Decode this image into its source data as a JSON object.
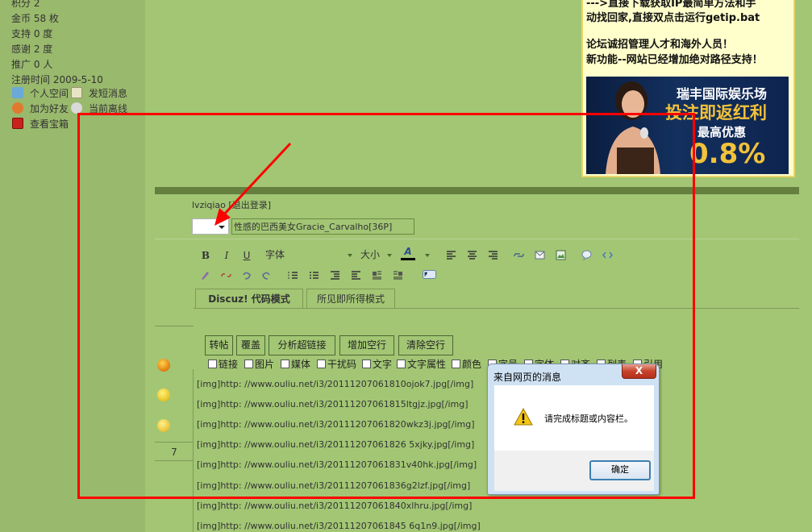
{
  "user_info": {
    "stats": [
      "积分 2",
      "金币 58 枚",
      "支持 0 度",
      "感谢 2 度",
      "推广 0 人",
      "注册时间  2009-5-10"
    ],
    "links": [
      {
        "label": "个人空间"
      },
      {
        "label": "发短消息"
      },
      {
        "label": "加为好友"
      },
      {
        "label": "当前离线"
      },
      {
        "label": "查看宝箱"
      }
    ]
  },
  "ad": {
    "lines": [
      "--->直接下载获取IP最简单方法和手",
      "动找回家,直接双点击运行getip.bat",
      "论坛诚招管理人才和海外人员！",
      "新功能--网站已经增加绝对路径支持！"
    ],
    "banner": {
      "title": "瑞丰国际娱乐场",
      "slogan": "投注即返红利",
      "sub": "最高优惠",
      "rate": "0.8%"
    }
  },
  "editor": {
    "login": "lvziqiao [退出登录]",
    "title_value": "性感的巴西美女Gracie_Carvalho[36P]",
    "toolbar": {
      "bold": "B",
      "italic": "I",
      "underline": "U",
      "font": "字体",
      "size": "大小",
      "color_letter": "A"
    },
    "tabs": [
      "Discuz! 代码模式",
      "所见即所得模式"
    ],
    "actions": [
      "转帖",
      "覆盖",
      "分析超链接",
      "增加空行",
      "清除空行"
    ],
    "checkboxes": [
      "链接",
      "图片",
      "媒体",
      "干扰码",
      "文字",
      "文字属性",
      "颜色",
      "字号",
      "字体",
      "对齐",
      "列表",
      "引用"
    ],
    "content_lines": [
      "[img]http: //www.ouliu.net/i3/20111207061810ojok7.jpg[/img]",
      "[img]http: //www.ouliu.net/i3/20111207061815ltgjz.jpg[/img]",
      "[img]http: //www.ouliu.net/i3/20111207061820wkz3j.jpg[/img]",
      "[img]http: //www.ouliu.net/i3/20111207061826 5xjky.jpg[/img]",
      "[img]http: //www.ouliu.net/i3/20111207061831v40hk.jpg[/img]",
      "[img]http: //www.ouliu.net/i3/20111207061836g2lzf.jpg[/img]",
      "[img]http: //www.ouliu.net/i3/20111207061840xlhru.jpg[/img]",
      "[img]http: //www.ouliu.net/i3/20111207061845 6q1n9.jpg[/img]"
    ],
    "left_number": "7"
  },
  "dialog": {
    "title": "来自网页的消息",
    "close": "X",
    "message": "请完成标题或内容栏。",
    "ok": "确定"
  },
  "colors": {
    "background": "#a2c674",
    "annotation": "#ff0000",
    "dialog_frame": "#cfe2f4"
  }
}
